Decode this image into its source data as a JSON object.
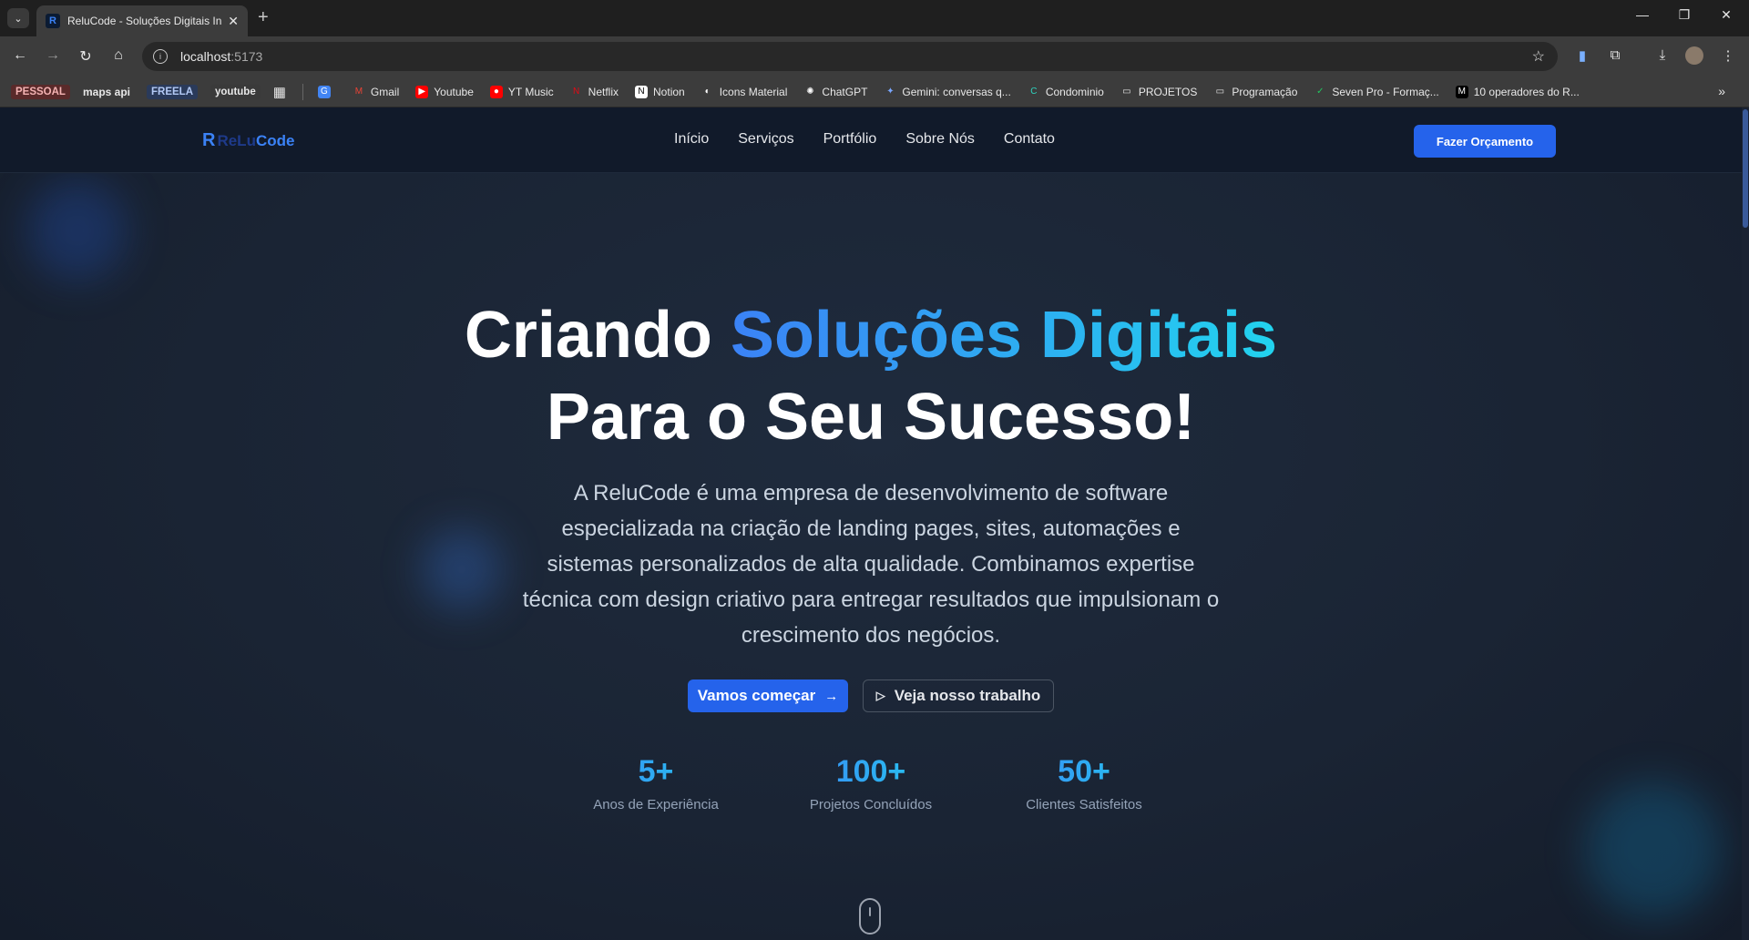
{
  "browser": {
    "tab_title": "ReluCode - Soluções Digitais In",
    "url_host": "localhost",
    "url_port": ":5173",
    "bookmarks": [
      {
        "label": "PESSOAL",
        "style": "pill",
        "bg": "#5a2a2a",
        "color": "#f4b3b3"
      },
      {
        "label": "maps api",
        "style": "plain"
      },
      {
        "label": "FREELA",
        "style": "pill",
        "bg": "#2a3a5a",
        "color": "#b3c9f4"
      },
      {
        "label": "youtube",
        "style": "pill",
        "bg": "#3a3a3a",
        "color": "#e8e8e8"
      },
      {
        "label": "Gmail",
        "icon": "gmail-icon"
      },
      {
        "label": "Youtube",
        "icon": "youtube-icon"
      },
      {
        "label": "YT Music",
        "icon": "ytmusic-icon"
      },
      {
        "label": "Netflix",
        "icon": "netflix-icon"
      },
      {
        "label": "Notion",
        "icon": "notion-icon"
      },
      {
        "label": "Icons Material",
        "icon": "material-icon"
      },
      {
        "label": "ChatGPT",
        "icon": "chatgpt-icon"
      },
      {
        "label": "Gemini: conversas q...",
        "icon": "gemini-icon"
      },
      {
        "label": "Condominio",
        "icon": "condominio-icon"
      },
      {
        "label": "PROJETOS",
        "icon": "folder-icon"
      },
      {
        "label": "Programação",
        "icon": "folder-icon"
      },
      {
        "label": "Seven Pro - Formaç...",
        "icon": "seven-icon"
      },
      {
        "label": "10 operadores do R...",
        "icon": "medium-icon"
      }
    ]
  },
  "site": {
    "logo_relu": "ReLu",
    "logo_code": "Code",
    "nav": [
      "Início",
      "Serviços",
      "Portfólio",
      "Sobre Nós",
      "Contato"
    ],
    "cta_header": "Fazer Orçamento",
    "hero": {
      "title_part1": "Criando ",
      "title_accent": "Soluções Digitais",
      "title_part2": "Para o Seu Sucesso!",
      "description": "A ReluCode é uma empresa de desenvolvimento de software especializada na criação de landing pages, sites, automações e sistemas personalizados de alta qualidade. Combinamos expertise técnica com design criativo para entregar resultados que impulsionam o crescimento dos negócios.",
      "btn_primary": "Vamos começar",
      "btn_secondary": "Veja nosso trabalho"
    },
    "stats": [
      {
        "value": "5+",
        "label": "Anos de Experiência"
      },
      {
        "value": "100+",
        "label": "Projetos Concluídos"
      },
      {
        "value": "50+",
        "label": "Clientes Satisfeitos"
      }
    ]
  },
  "colors": {
    "brand": "#2563eb",
    "accent_from": "#3b82f6",
    "accent_to": "#22d3ee",
    "page_bg": "#1a2434"
  }
}
